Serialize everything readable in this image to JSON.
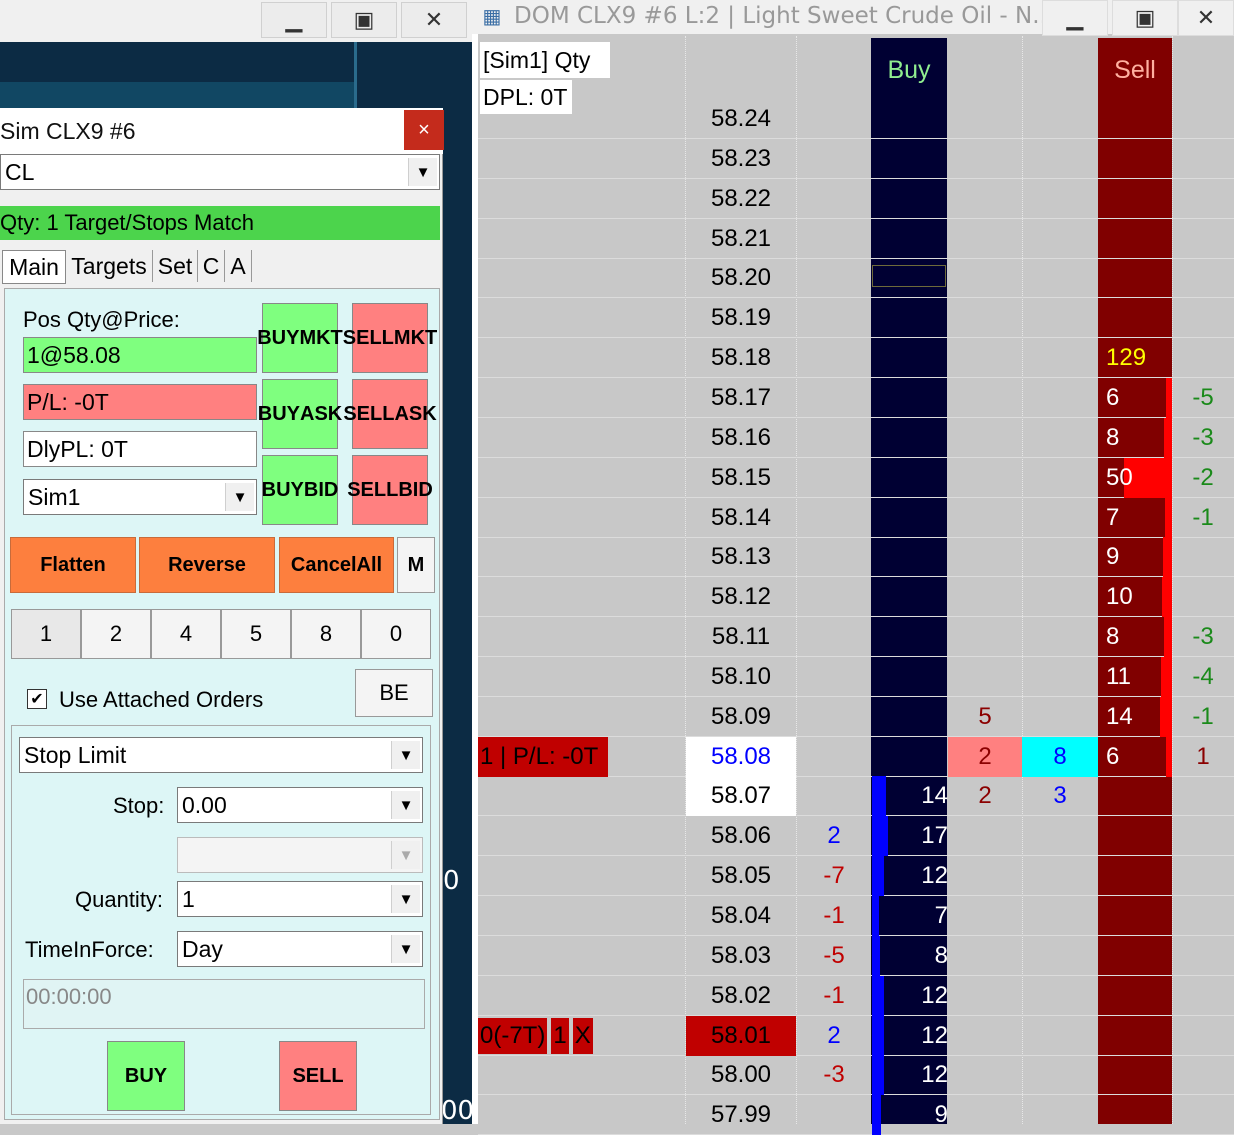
{
  "left_window": {
    "fragments": [
      "0",
      "00"
    ]
  },
  "dialog": {
    "title": "Sim CLX9  #6",
    "close": "×",
    "symbol": "CL",
    "status": "Qty: 1 Target/Stops Match",
    "tabs": [
      "Main",
      "Targets",
      "Set",
      "C",
      "A"
    ],
    "pos_label": "Pos Qty@Price:",
    "pos_value": "1@58.08",
    "pl_value": "P/L: -0T",
    "dlypl_value": "DlyPL: 0T",
    "account": "Sim1",
    "buttons": {
      "buy_mkt": [
        "BUY",
        "MKT"
      ],
      "sell_mkt": [
        "SELL",
        "MKT"
      ],
      "buy_ask": [
        "BUY",
        "ASK"
      ],
      "sell_ask": [
        "SELL",
        "ASK"
      ],
      "buy_bid": [
        "BUY",
        "BID"
      ],
      "sell_bid": [
        "SELL",
        "BID"
      ],
      "flatten": "Flatten",
      "reverse": "Reverse",
      "cancel_all": "CancelAll",
      "m": "M",
      "be": "BE",
      "buy": "BUY",
      "sell": "SELL"
    },
    "qty_buttons": [
      "1",
      "2",
      "4",
      "5",
      "8",
      "0"
    ],
    "use_attached_label": "Use Attached Orders",
    "use_attached_checked": true,
    "order_type": "Stop Limit",
    "stop_label": "Stop:",
    "stop_value": "0.00",
    "quantity_label": "Quantity:",
    "quantity_value": "1",
    "tif_label": "TimeInForce:",
    "tif_value": "Day",
    "time_value": "00:00:00"
  },
  "dom": {
    "title": "DOM  CLX9  #6  L:2 | Light Sweet Crude Oil - N...",
    "account_label": "[Sim1]  Qty",
    "dpl_label": "DPL: 0T",
    "buy_header": "Buy",
    "sell_header": "Sell",
    "rows": [
      {
        "price": "58.24",
        "sell": "",
        "c7": ""
      },
      {
        "price": "58.23",
        "sell": "",
        "c7": ""
      },
      {
        "price": "58.22",
        "sell": "",
        "c7": ""
      },
      {
        "price": "58.21",
        "sell": "",
        "c7": ""
      },
      {
        "price": "58.20",
        "sell": "",
        "c7": ""
      },
      {
        "price": "58.19",
        "sell": "",
        "c7": ""
      },
      {
        "price": "58.18",
        "sell": "129",
        "c7": ""
      },
      {
        "price": "58.17",
        "sell": "6",
        "c7": "-5"
      },
      {
        "price": "58.16",
        "sell": "8",
        "c7": "-3"
      },
      {
        "price": "58.15",
        "sell": "50",
        "c7": "-2"
      },
      {
        "price": "58.14",
        "sell": "7",
        "c7": "-1"
      },
      {
        "price": "58.13",
        "sell": "9",
        "c7": ""
      },
      {
        "price": "58.12",
        "sell": "10",
        "c7": ""
      },
      {
        "price": "58.11",
        "sell": "8",
        "c7": "-3"
      },
      {
        "price": "58.10",
        "sell": "11",
        "c7": "-4"
      },
      {
        "price": "58.09",
        "sell": "14",
        "c7": "-1",
        "c4": "5"
      },
      {
        "price": "58.08",
        "sell": "6",
        "c7": "1",
        "c4": "2",
        "c5": "8",
        "pos": "1 | P/L: -0T"
      },
      {
        "price": "58.07",
        "buy": "14",
        "c4": "2",
        "c5": "3"
      },
      {
        "price": "58.06",
        "buy": "17",
        "c2": "2"
      },
      {
        "price": "58.05",
        "buy": "12",
        "c2": "-7"
      },
      {
        "price": "58.04",
        "buy": "7",
        "c2": "-1"
      },
      {
        "price": "58.03",
        "buy": "8",
        "c2": "-5"
      },
      {
        "price": "58.02",
        "buy": "12",
        "c2": "-1"
      },
      {
        "price": "58.01",
        "buy": "12",
        "c2": "2",
        "order": [
          "0(-7T)",
          "1",
          "X"
        ]
      },
      {
        "price": "58.00",
        "buy": "12",
        "c2": "-3"
      },
      {
        "price": "57.99",
        "buy": "9",
        "c2": ""
      }
    ],
    "colors": {
      "buy_column": "#000033",
      "sell_column": "#800000",
      "buy_header": "#90ee90",
      "sell_header": "#ffb0a0",
      "last_price": "#0000ff"
    }
  }
}
